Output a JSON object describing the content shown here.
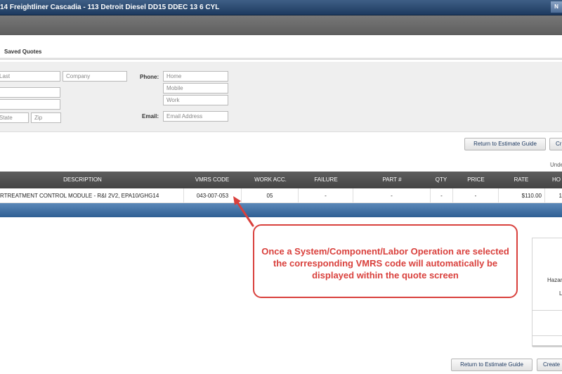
{
  "window": {
    "title": "14 Freightliner Cascadia - 113 Detroit Diesel DD15 DDEC 13 6 CYL",
    "corner_label": "N"
  },
  "tabs": {
    "saved_quotes": "Saved Quotes"
  },
  "form": {
    "last_placeholder": "Last",
    "company_placeholder": "Company",
    "state_placeholder": "State",
    "zip_placeholder": "Zip",
    "phone_label": "Phone:",
    "home_placeholder": "Home",
    "mobile_placeholder": "Mobile",
    "work_placeholder": "Work",
    "email_label": "Email:",
    "email_placeholder": "Email Address"
  },
  "actions_top": {
    "return_label": "Return to Estimate Guide",
    "create_label": "Cr",
    "under_text": "Unde"
  },
  "table": {
    "headers": [
      "DESCRIPTION",
      "VMRS CODE",
      "WORK ACC.",
      "FAILURE",
      "PART #",
      "QTY",
      "PRICE",
      "RATE",
      "HO"
    ],
    "row": {
      "description": "RTREATMENT CONTROL MODULE - R&I 2V2, EPA10/GHG14",
      "vmrs": "043-007-053",
      "work_acc": "05",
      "failure": "-",
      "part": "-",
      "qty": "-",
      "price": "-",
      "rate": "$110.00",
      "ho": "1"
    }
  },
  "callout": {
    "text": "Once a System/Component/Labor Operation are selected the corresponding VMRS code will automatically be displayed within the quote screen",
    "color": "#d9403c"
  },
  "side_panel": {
    "hazard": "Hazar",
    "l": "L"
  },
  "actions_bottom": {
    "return_label": "Return to Estimate Guide",
    "create_label": "Create"
  }
}
